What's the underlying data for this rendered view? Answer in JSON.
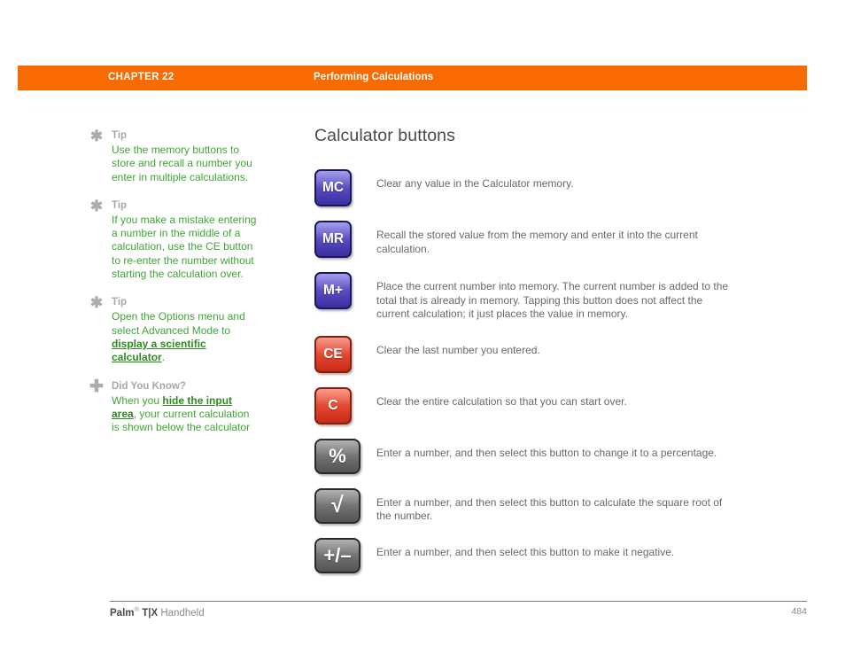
{
  "header": {
    "chapter": "CHAPTER 22",
    "section": "Performing Calculations",
    "band_color": "#F96A00"
  },
  "sidebar": {
    "items": [
      {
        "icon": "asterisk-icon",
        "heading": "Tip",
        "body_parts": [
          {
            "type": "text",
            "text": "Use the memory buttons to store and recall a number you enter in multiple calculations."
          }
        ]
      },
      {
        "icon": "asterisk-icon",
        "heading": "Tip",
        "body_parts": [
          {
            "type": "text",
            "text": "If you make a mistake entering a number in the middle of a calculation, use the CE button to re-enter the number without starting the calculation over."
          }
        ]
      },
      {
        "icon": "asterisk-icon",
        "heading": "Tip",
        "body_parts": [
          {
            "type": "text",
            "text": "Open the Options menu and select Advanced Mode to "
          },
          {
            "type": "link",
            "text": "display a scientific calculator"
          },
          {
            "type": "text",
            "text": "."
          }
        ]
      },
      {
        "icon": "plus-icon",
        "heading": "Did You Know?",
        "body_parts": [
          {
            "type": "text",
            "text": "When you "
          },
          {
            "type": "link",
            "text": "hide the input area"
          },
          {
            "type": "text",
            "text": ", your current calculation is shown below the calculator"
          }
        ]
      }
    ],
    "text_color": "#3FA535",
    "heading_color": "#A8A8A8"
  },
  "main": {
    "title": "Calculator buttons",
    "buttons": [
      {
        "label": "MC",
        "glyph_type": "text",
        "style": "blue",
        "wide": false,
        "description": "Clear any value in the Calculator memory."
      },
      {
        "label": "MR",
        "glyph_type": "text",
        "style": "blue",
        "wide": false,
        "description": "Recall the stored value from the memory and enter it into the current calculation."
      },
      {
        "label": "M+",
        "glyph_type": "text",
        "style": "blue",
        "wide": false,
        "description": "Place the current number into memory. The current number is added to the total that is already in memory. Tapping this button does not affect the current calculation; it just places the value in memory."
      },
      {
        "label": "CE",
        "glyph_type": "text",
        "style": "red",
        "wide": false,
        "description": "Clear the last number you entered."
      },
      {
        "label": "C",
        "glyph_type": "text",
        "style": "red",
        "wide": false,
        "description": "Clear the entire calculation so that you can start over."
      },
      {
        "label": "%",
        "glyph_type": "sym",
        "style": "gray",
        "wide": true,
        "description": "Enter a number, and then select this button to change it to a percentage."
      },
      {
        "label": "√",
        "glyph_type": "sqrt",
        "style": "gray",
        "wide": true,
        "description": "Enter a number, and then select this button to calculate the square root of the number."
      },
      {
        "label": "+/–",
        "glyph_type": "sym",
        "style": "gray",
        "wide": true,
        "description": "Enter a number, and then select this button to make it negative."
      }
    ]
  },
  "footer": {
    "brand": "Palm",
    "registered_mark": "®",
    "product": "T|X",
    "suffix": "Handheld",
    "page_number": "484"
  }
}
